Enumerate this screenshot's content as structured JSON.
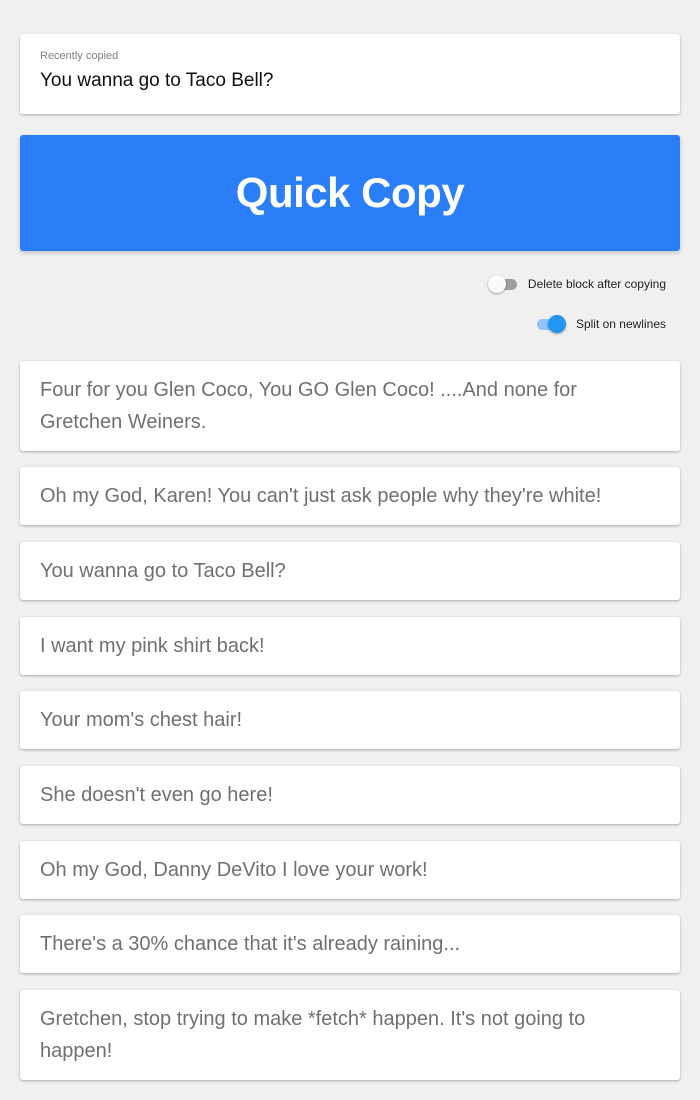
{
  "recent": {
    "label": "Recently copied",
    "text": "You wanna go to Taco Bell?"
  },
  "quick_copy": {
    "label": "Quick Copy",
    "color": "#2a7ff8"
  },
  "toggles": {
    "delete_after_copy": {
      "label": "Delete block after copying",
      "on": false
    },
    "split_newlines": {
      "label": "Split on newlines",
      "on": true,
      "color": "#2196f3"
    }
  },
  "blocks": [
    {
      "text": "Four for you Glen Coco, You GO Glen Coco! ....And none for Gretchen Weiners."
    },
    {
      "text": "Oh my God, Karen! You can't just ask people why they're white!"
    },
    {
      "text": "You wanna go to Taco Bell?"
    },
    {
      "text": "I want my pink shirt back!"
    },
    {
      "text": "Your mom's chest hair!"
    },
    {
      "text": "She doesn't even go here!"
    },
    {
      "text": "Oh my God, Danny DeVito I love your work!"
    },
    {
      "text": "There's a 30% chance that it's already raining..."
    },
    {
      "text": "Gretchen, stop trying to make *fetch* happen. It's not going to happen!"
    }
  ]
}
